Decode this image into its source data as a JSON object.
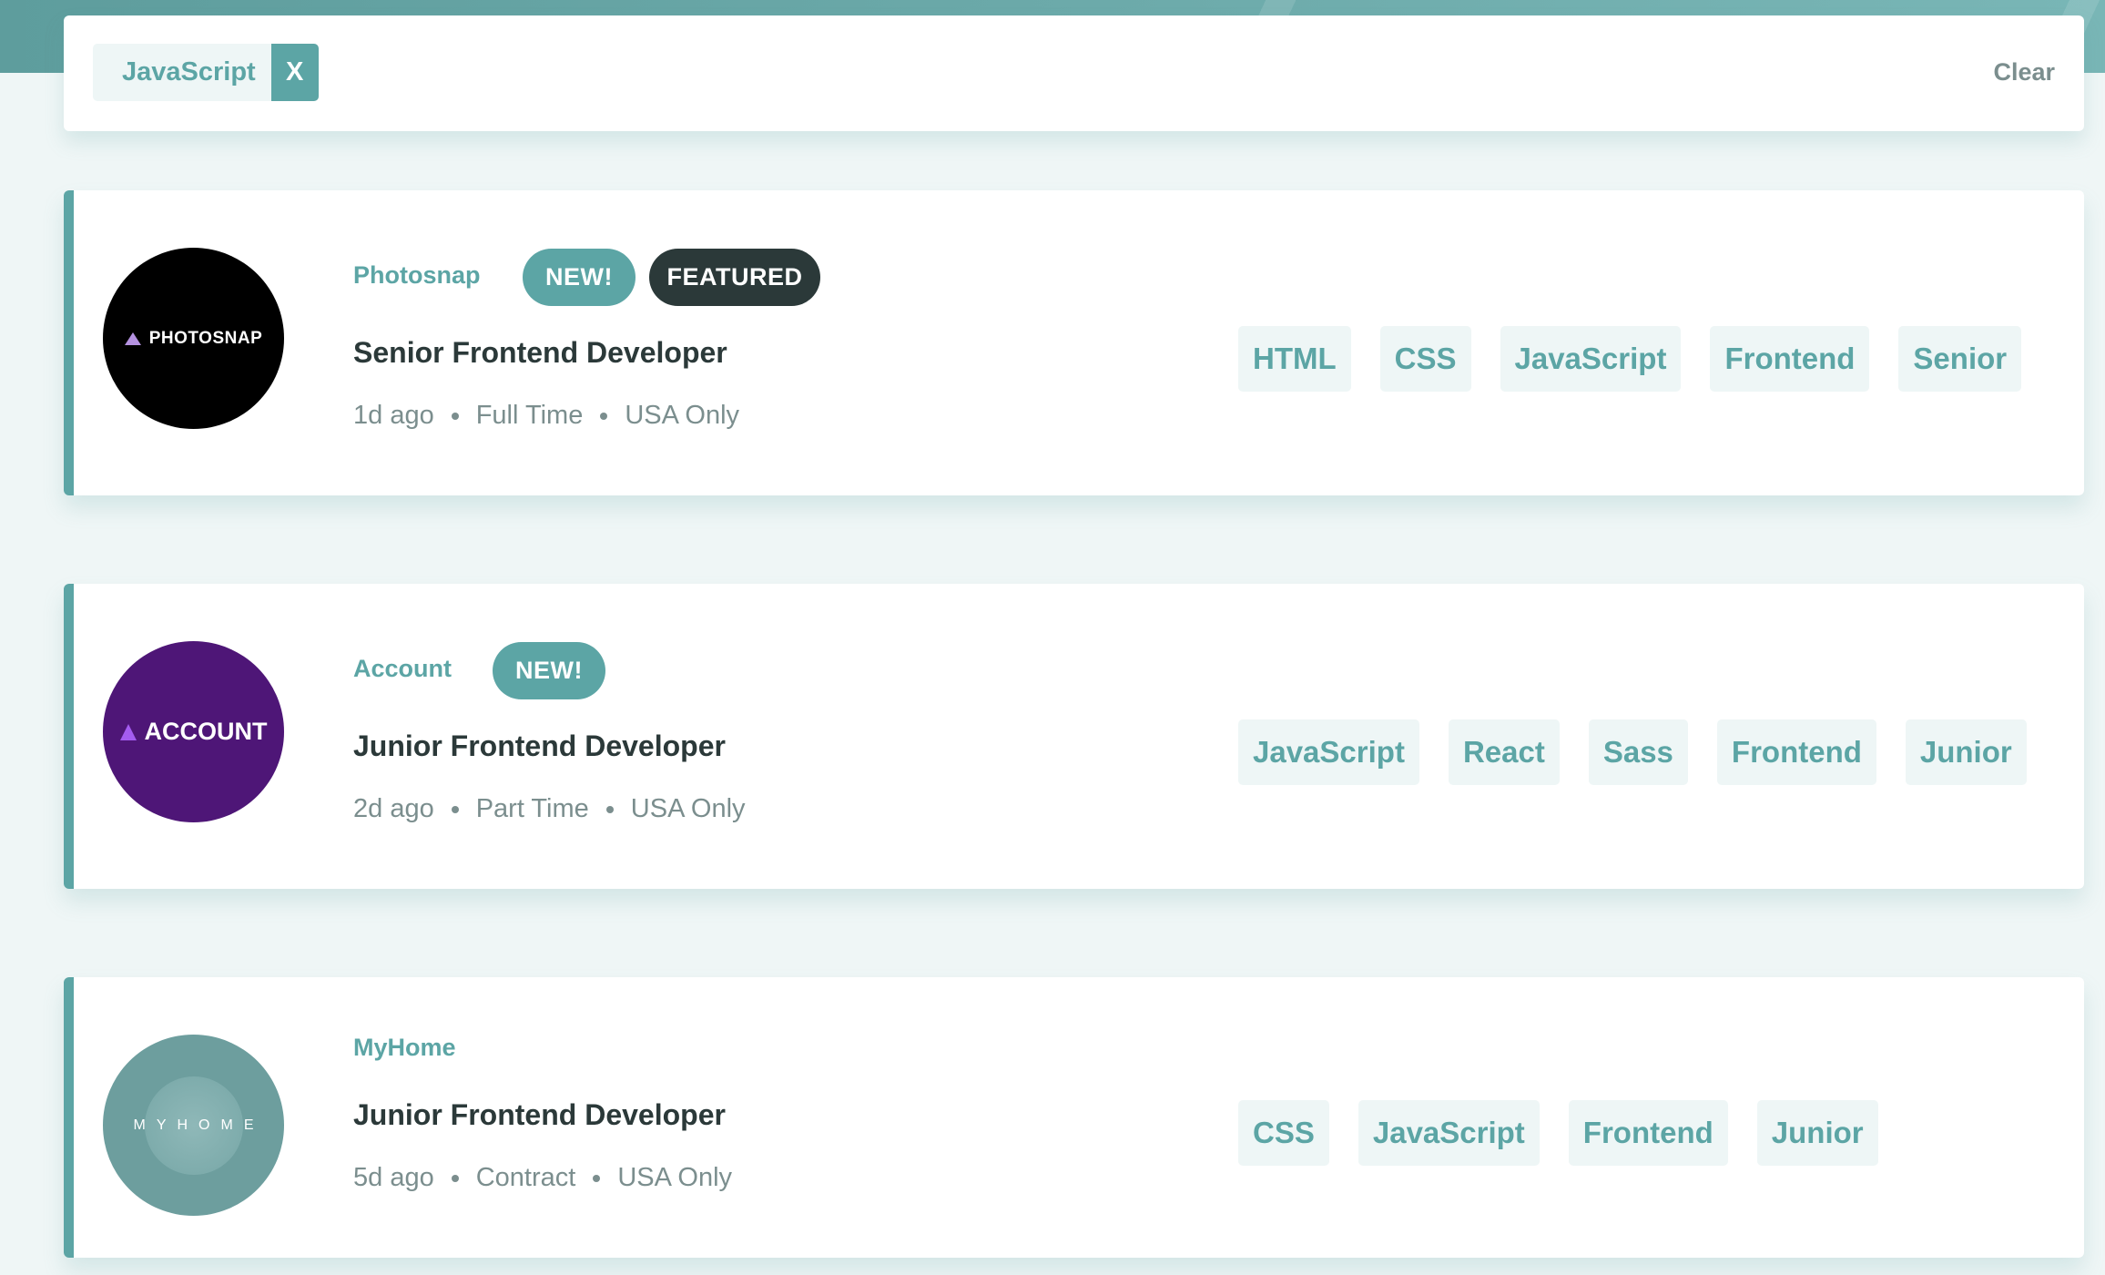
{
  "filter_bar": {
    "filters": [
      {
        "label": "JavaScript",
        "remove_label": "X"
      }
    ],
    "clear_label": "Clear"
  },
  "jobs": [
    {
      "company": "Photosnap",
      "logo_text": "PHOTOSNAP",
      "badges": {
        "new": "NEW!",
        "featured": "FEATURED"
      },
      "position": "Senior Frontend Developer",
      "posted": "1d ago",
      "contract": "Full Time",
      "location": "USA Only",
      "tags": [
        "HTML",
        "CSS",
        "JavaScript",
        "Frontend",
        "Senior"
      ]
    },
    {
      "company": "Account",
      "logo_text": "ACCOUNT",
      "badges": {
        "new": "NEW!"
      },
      "position": "Junior Frontend Developer",
      "posted": "2d ago",
      "contract": "Part Time",
      "location": "USA Only",
      "tags": [
        "JavaScript",
        "React",
        "Sass",
        "Frontend",
        "Junior"
      ]
    },
    {
      "company": "MyHome",
      "logo_text": "MYHOME",
      "position": "Junior Frontend Developer",
      "posted": "5d ago",
      "contract": "Contract",
      "location": "USA Only",
      "tags": [
        "CSS",
        "JavaScript",
        "Frontend",
        "Junior"
      ]
    }
  ],
  "colors": {
    "accent": "#5ca5a5",
    "background": "#eff6f6",
    "dark": "#2b3939",
    "muted": "#7b8e8e",
    "tag_bg": "#eef6f6"
  }
}
